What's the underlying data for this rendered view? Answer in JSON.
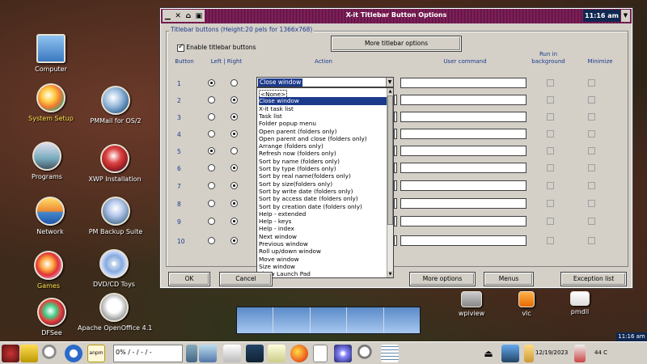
{
  "desktop": {
    "icons": [
      {
        "label": "Computer"
      },
      {
        "label": "System Setup"
      },
      {
        "label": "PMMail for OS/2"
      },
      {
        "label": "Programs"
      },
      {
        "label": "XWP Installation"
      },
      {
        "label": "Network"
      },
      {
        "label": "PM Backup Suite"
      },
      {
        "label": "Games"
      },
      {
        "label": "DVD/CD Toys"
      },
      {
        "label": "DFSee"
      },
      {
        "label": "Apache OpenOffice 4.1"
      },
      {
        "label": "wpiview"
      },
      {
        "label": "vlc"
      },
      {
        "label": "pmdll"
      }
    ]
  },
  "dialog": {
    "title": "X-it Titlebar Button Options",
    "clock": "11:16 am",
    "group_label": "Titlebar buttons   (Height:20 pels for 1366x768)",
    "enable_label": "Enable titlebar buttons",
    "enable_checked": true,
    "more_titlebar_label": "More titlebar options",
    "headers": {
      "button": "Button",
      "left_right": "Left | Right",
      "action": "Action",
      "user_command": "User command",
      "run_bg": "Run in\nbackground",
      "minimize": "Minimize"
    },
    "rows": [
      {
        "num": "1",
        "side": "left"
      },
      {
        "num": "2",
        "side": "right"
      },
      {
        "num": "3",
        "side": "right"
      },
      {
        "num": "4",
        "side": "right"
      },
      {
        "num": "5",
        "side": "left"
      },
      {
        "num": "6",
        "side": "right"
      },
      {
        "num": "7",
        "side": "right"
      },
      {
        "num": "8",
        "side": "right"
      },
      {
        "num": "9",
        "side": "right"
      },
      {
        "num": "10",
        "side": "right"
      }
    ],
    "combo_value": "Close window",
    "dropdown_items": [
      "<None>",
      "Close window",
      "X-it task list",
      "Task list",
      "Folder popup menu",
      "Open parent (folders only)",
      "Open parent and close (folders only)",
      "Arrange (folders only)",
      "Refresh now (folders only)",
      "Sort by name (folders only)",
      "Sort by type (folders only)",
      "Sort by real name(folders only)",
      "Sort by size(folders only)",
      "Sort by write date (folders only)",
      "Sort by access date (folders only)",
      "Sort by creation date (folders only)",
      "Help - extended",
      "Help - keys",
      "Help - index",
      "Next window",
      "Previous window",
      "Roll up/down window",
      "Move window",
      "Size window",
      "Show Launch Pad"
    ],
    "dropdown_highlighted_index": 1,
    "buttons": {
      "ok": "OK",
      "cancel": "Cancel",
      "more_options": "More options",
      "menus": "Menus",
      "exception_list": "Exception list"
    }
  },
  "taskbar": {
    "cpu_text": "0% / - / - / -",
    "date": "12/19/2023",
    "temp": "44 C",
    "clock": "11:16 am",
    "anpm_label": "anpm",
    "cancel_partial": "Cancel"
  }
}
